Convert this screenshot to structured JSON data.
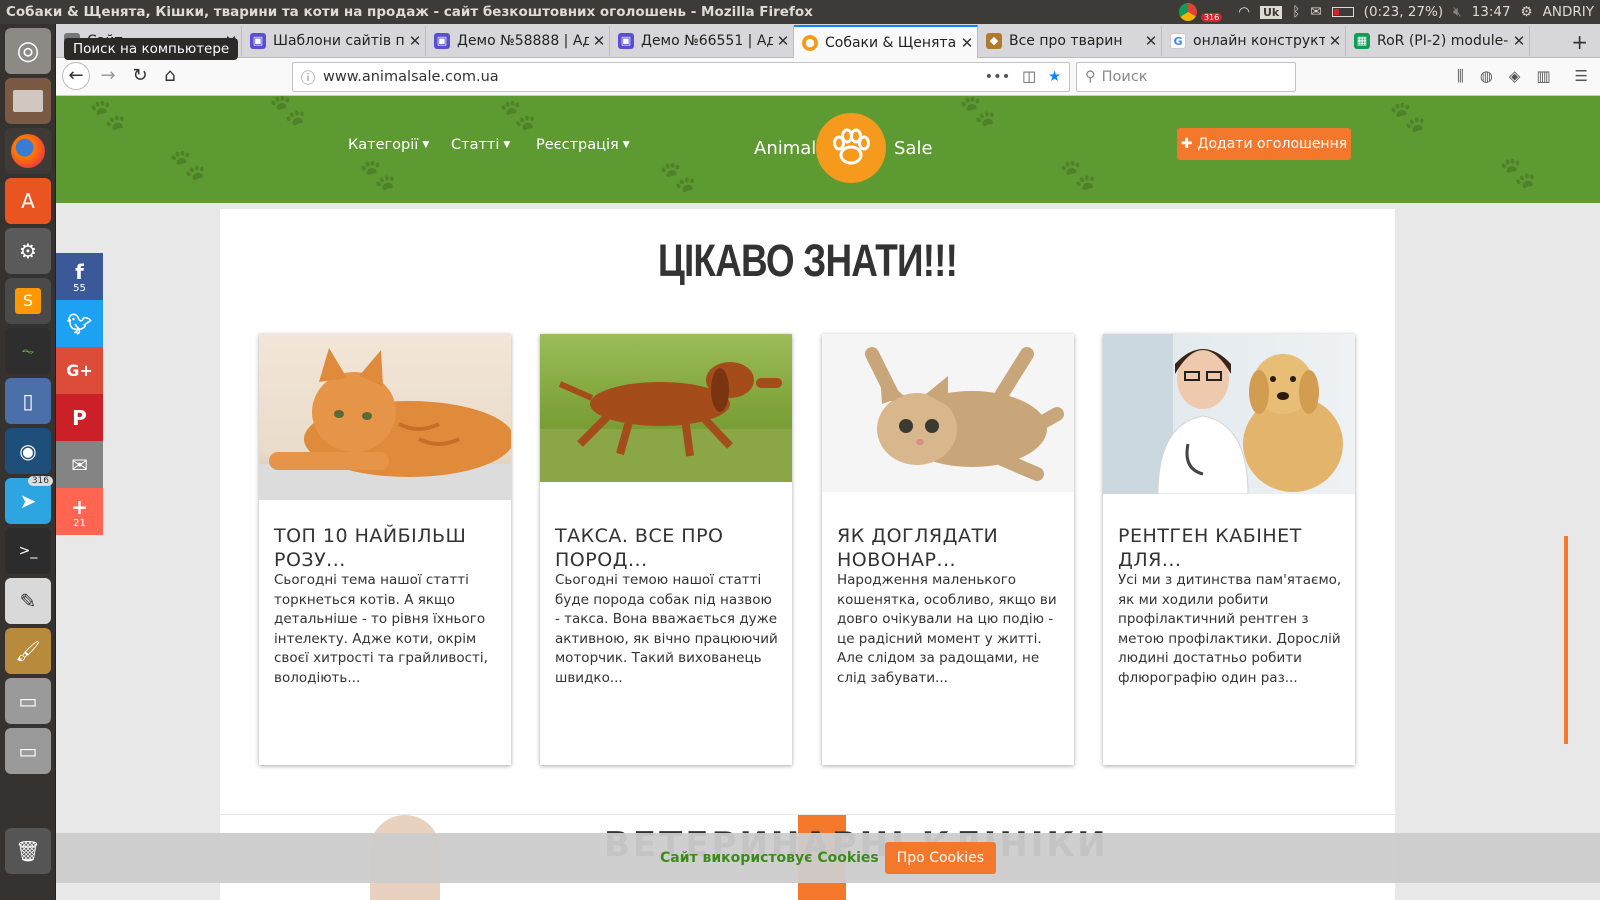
{
  "os_panel": {
    "window_title": "Собаки & Щенята, Кішки, тварини та коти на продаж - сайт безкоштовних оголошень - Mozilla Firefox",
    "notification_count": "316",
    "keyboard_layout": "Uk",
    "battery": "(0:23, 27%)",
    "time": "13:47",
    "user": "ANDRIY"
  },
  "launcher": {
    "tooltip": "Поиск на компьютере",
    "telegram_badge": "316"
  },
  "tabs": [
    {
      "title": "Сайт..."
    },
    {
      "title": "Шаблони сайтів п"
    },
    {
      "title": "Демо №58888 | Ад"
    },
    {
      "title": "Демо №66551 | Ад"
    },
    {
      "title": "Собаки & Щенята,"
    },
    {
      "title": "Все про тварин"
    },
    {
      "title": "онлайн конструкт"
    },
    {
      "title": "RoR (PI-2) module-"
    }
  ],
  "urlbar": {
    "url": "www.animalsale.com.ua"
  },
  "searchbar": {
    "placeholder": "Поиск"
  },
  "site": {
    "menu": [
      {
        "label": "Категорії"
      },
      {
        "label": "Статті"
      },
      {
        "label": "Реєстрація"
      }
    ],
    "logo_left": "Animal",
    "logo_right": "Sale",
    "add_button": "Додати оголошення",
    "section_title": "ЦІКАВО ЗНАТИ!!!",
    "cards": [
      {
        "title": "ТОП 10 НАЙБІЛЬШ РОЗУ...",
        "text": "Сьогодні тема нашої статті торкнеться котів. А якщо детальніше - то рівня їхнього інтелекту. Адже коти, окрім своєї хитрості та грайливості, володіють...",
        "image": "ginger-cat"
      },
      {
        "title": "ТАКСА. ВСЕ ПРО ПОРОД...",
        "text": "Сьогодні темою нашої статті буде порода собак під назвою - такса. Вона вважається дуже активною, як вічно працюючий моторчик. Такий вихованець швидко...",
        "image": "dachshund"
      },
      {
        "title": "ЯК ДОГЛЯДАТИ НОВОНАР...",
        "text": "Народження маленького кошенятка, особливо, якщо ви довго очікували на цю подію - це радісний момент у житті. Але слідом за радощами, не слід забувати...",
        "image": "kitten"
      },
      {
        "title": "РЕНТГЕН КАБІНЕТ ДЛЯ...",
        "text": "Усі ми з дитинства пам'ятаємо, як ми ходили робити профілактичний рентген з метою профілактики. Дорослій людині достатньо робити флюрографію один раз...",
        "image": "vet-with-dog"
      }
    ],
    "next_section_title": "ВЕТЕРИНАРНІ КЛІНІКИ"
  },
  "share": {
    "facebook_count": "55",
    "plus_count": "21"
  },
  "cookie": {
    "text": "Сайт використовує Cookies",
    "button": "Про Cookies"
  },
  "colors": {
    "header_green": "#5e9a32",
    "accent_orange": "#f4782b",
    "logo_orange": "#f59a1c",
    "cookie_text_green": "#3c8c1c"
  }
}
